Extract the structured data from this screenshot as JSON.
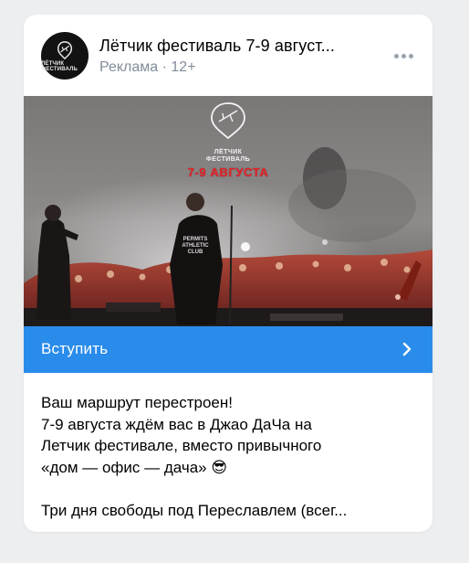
{
  "post": {
    "avatar_text": "ЛЁТЧИК ФЕСТИВАЛЬ",
    "avatar_icon": "pilot-logo-icon",
    "title": "Лётчик фестиваль 7-9 август...",
    "subtitle": "Реклама · 12+",
    "more_icon": "more-dots-icon"
  },
  "banner": {
    "logo_line1": "ЛЁТЧИК",
    "logo_line2": "ФЕСТИВАЛЬ",
    "dates": "7-9 АВГУСТА",
    "shirt_text": "PERMITS ATHLETIC CLUB",
    "dates_color": "#e2252b"
  },
  "cta": {
    "label": "Вступить",
    "icon": "chevron-right-icon",
    "color": "#2a8cea"
  },
  "text": {
    "lines": [
      "Ваш маршрут перестроен!",
      "7-9 августа ждём вас в Джао ДаЧа на",
      "Летчик фестивале, вместо привычного",
      "«дом — офис — дача» 😎",
      "",
      "Три дня свободы под Переславлем (всег..."
    ]
  }
}
